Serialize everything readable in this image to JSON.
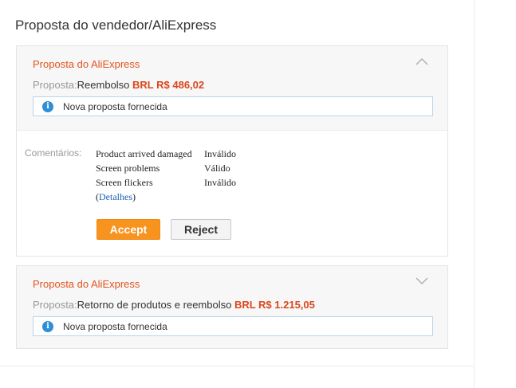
{
  "section_title": "Proposta do vendedor/AliExpress",
  "proposals": [
    {
      "title": "Proposta do AliExpress",
      "chevron_icon": "chevron-up-icon",
      "label": "Proposta:",
      "type": "Reembolso ",
      "amount": "BRL R$ 486,02",
      "notice": {
        "icon": "info-icon",
        "text": "Nova proposta fornecida"
      },
      "comments": {
        "label": "Comentários:",
        "items": [
          {
            "issue": "Product arrived damaged",
            "status": "Inválido"
          },
          {
            "issue": "Screen problems",
            "status": "Válido"
          },
          {
            "issue": "Screen flickers",
            "status": "Inválido"
          }
        ],
        "details_open": "(",
        "details_link": "Detalhes",
        "details_close": ")"
      },
      "actions": {
        "accept": "Accept",
        "reject": "Reject"
      }
    },
    {
      "title": "Proposta do AliExpress",
      "chevron_icon": "chevron-down-icon",
      "label": "Proposta:",
      "type": "Retorno de produtos e reembolso ",
      "amount": "BRL R$ 1.215,05",
      "notice": {
        "icon": "info-icon",
        "text": "Nova proposta fornecida"
      }
    }
  ],
  "colors": {
    "title_orange": "#e1541e",
    "amount_red": "#d9471c",
    "accept_orange": "#f7931e",
    "info_blue": "#2e8fd6",
    "notice_border": "#b8d3ea",
    "link_blue": "#1a5fb4"
  }
}
